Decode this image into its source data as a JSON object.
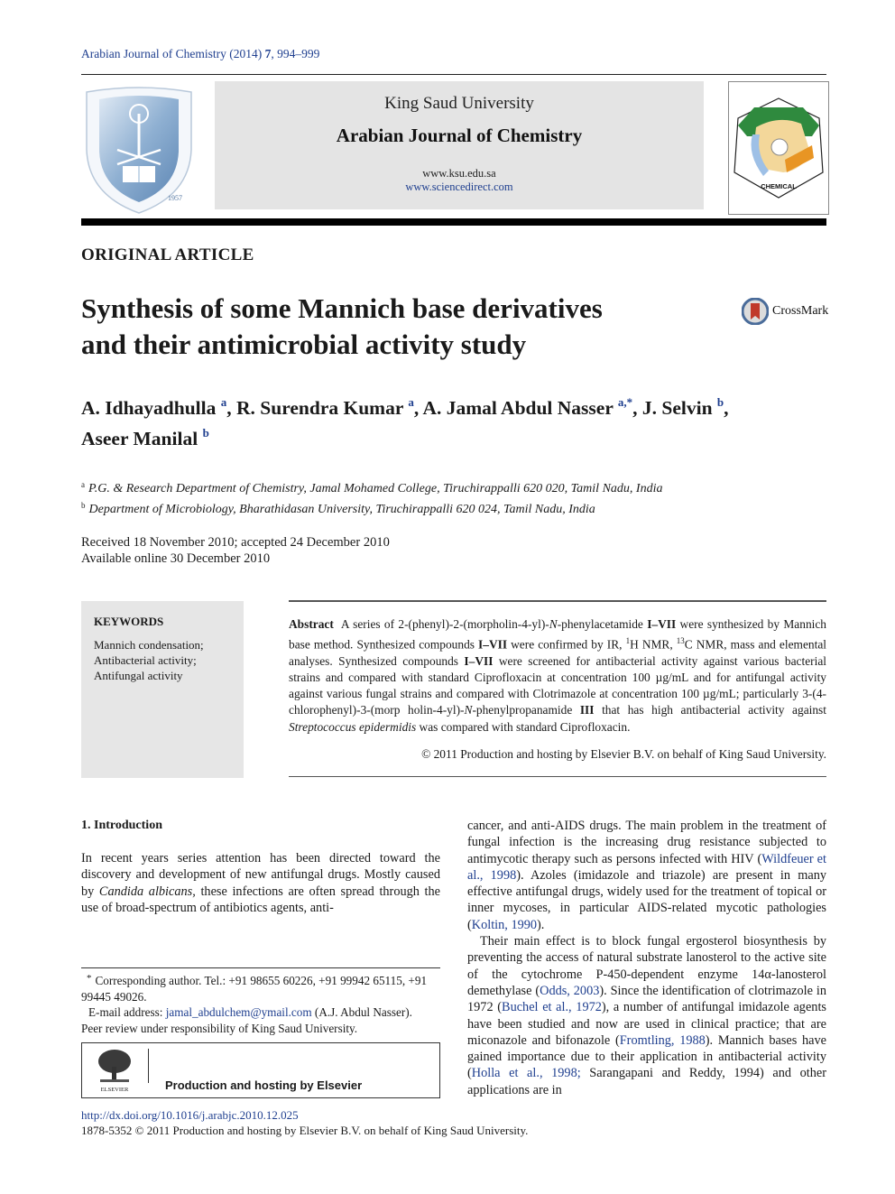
{
  "header": {
    "journal_ref_prefix": "Arabian Journal of Chemistry (2014) ",
    "journal_ref_volume": "7",
    "journal_ref_pages": ", 994–999",
    "university": "King Saud University",
    "journal_name": "Arabian Journal of Chemistry",
    "url1": "www.ksu.edu.sa",
    "url2": "www.sciencedirect.com",
    "scs_logo_text": "CHEMICAL",
    "ksu_logo_year": "1957"
  },
  "article": {
    "type": "ORIGINAL ARTICLE",
    "title_line1": "Synthesis of some Mannich base derivatives",
    "title_line2": "and their antimicrobial activity study",
    "crossmark": "CrossMark",
    "authors": [
      {
        "name": "A. Idhayadhulla ",
        "sup": "a",
        "sep": ", "
      },
      {
        "name": "R. Surendra Kumar ",
        "sup": "a",
        "sep": ", "
      },
      {
        "name": "A. Jamal Abdul Nasser ",
        "sup": "a,*",
        "sep": ", "
      },
      {
        "name": "J. Selvin ",
        "sup": "b",
        "sep": ","
      },
      {
        "name": "Aseer Manilal ",
        "sup": "b",
        "sep": ""
      }
    ],
    "affiliations": [
      {
        "mark": "a",
        "text": "P.G. & Research Department of Chemistry, Jamal Mohamed College, Tiruchirappalli 620 020, Tamil Nadu, India"
      },
      {
        "mark": "b",
        "text": "Department of Microbiology, Bharathidasan University, Tiruchirappalli 620 024, Tamil Nadu, India"
      }
    ],
    "received": "Received 18 November 2010; accepted 24 December 2010",
    "available": "Available online 30 December 2010"
  },
  "keywords": {
    "title": "KEYWORDS",
    "items": [
      "Mannich condensation;",
      "Antibacterial activity;",
      "Antifungal activity"
    ]
  },
  "abstract": {
    "label": "Abstract",
    "p1": "A series of 2-(phenyl)-2-(morpholin-4-yl)-",
    "n1": "N",
    "p2": "-phenylacetamide ",
    "b1": "I–VII",
    "p3": " were synthesized by Mannich base method. Synthesized compounds ",
    "b2": "I–VII",
    "p4": " were confirmed by IR, ",
    "sup1": "1",
    "p5": "H NMR, ",
    "sup2": "13",
    "p6": "C NMR, mass and elemental analyses. Synthesized compounds ",
    "b3": "I–VII",
    "p7": " were screened for antibacterial activity against various bacterial strains and compared with standard Ciprofloxacin at concentration 100 µg/mL and for antifungal activity against various fungal strains and compared with Clotrimazole at concentration 100 µg/mL; particularly 3-(4-chlorophenyl)-3-(morp holin-4-yl)-",
    "n2": "N",
    "p8": "-phenylpropanamide ",
    "b4": "III",
    "p9": " that has high antibacterial activity against ",
    "i1": "Streptococcus epidermidis",
    "p10": " was compared with standard Ciprofloxacin.",
    "copyright": "© 2011 Production and hosting by Elsevier B.V. on behalf of King Saud University."
  },
  "intro": {
    "heading": "1. Introduction",
    "left_p1a": "In recent years series attention has been directed toward the discovery and development of new antifungal drugs. Mostly caused by ",
    "left_i1": "Candida albicans,",
    "left_p1b": " these infections are often spread through the use of broad-spectrum of antibiotics agents, anti-",
    "right_p1a": "cancer, and anti-AIDS drugs. The main problem in the treatment of fungal infection is the increasing drug resistance subjected to antimycotic therapy such as persons infected with HIV (",
    "ref1": "Wildfeuer et al., 1998",
    "right_p1b": "). Azoles (imidazole and triazole) are present in many effective antifungal drugs, widely used for the treatment of topical or inner mycoses, in particular AIDS-related mycotic pathologies (",
    "ref2": "Koltin, 1990",
    "right_p1c": ").",
    "right_p2a": "Their main effect is to block fungal ergosterol biosynthesis by preventing the access of natural substrate lanosterol to the active site of the cytochrome P-450-dependent enzyme 14α-lanosterol demethylase (",
    "ref3": "Odds, 2003",
    "right_p2b": "). Since the identification of clotrimazole in 1972 (",
    "ref4": "Buchel et al., 1972",
    "right_p2c": "), a number of antifungal imidazole agents have been studied and now are used in clinical practice; that are miconazole and bifonazole (",
    "ref5": "Fromtling, 1988",
    "right_p2d": "). Mannich bases have gained importance due to their application in antibacterial activity (",
    "ref6": "Holla et al., 1998;",
    "right_p2e": " Sarangapani and Reddy, 1994) and other applications are in"
  },
  "footnote": {
    "star": "*",
    "corresponding": "Corresponding author. Tel.: +91 98655 60226, +91 99942 65115, +91 99445 49026.",
    "email_label": "E-mail address: ",
    "email": "jamal_abdulchem@ymail.com",
    "email_suffix": " (A.J. Abdul Nasser).",
    "peer_review": "Peer review under responsibility of King Saud University.",
    "elsevier_logo_text": "ELSEVIER",
    "production": "Production and hosting by Elsevier"
  },
  "footer": {
    "doi": "http://dx.doi.org/10.1016/j.arabjc.2010.12.025",
    "issn_line": "1878-5352 © 2011 Production and hosting by Elsevier B.V. on behalf of King Saud University."
  },
  "colors": {
    "link": "#1f3f8f",
    "banner_bg": "#e4e4e4",
    "keywords_bg": "#e6e6e6"
  }
}
